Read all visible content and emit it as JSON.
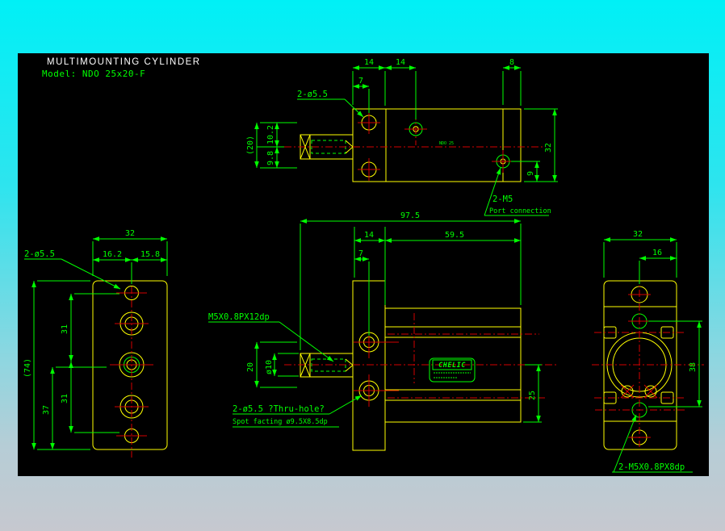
{
  "window": {
    "backdrop_top_color": "#00f0f6",
    "backdrop_bottom_color": "#c6c8cf",
    "canvas_color": "#000000"
  },
  "colors": {
    "outline": "#ffff00",
    "dimension": "#00ff00",
    "centerline": "#d40000",
    "title_text": "#ffffff"
  },
  "title": {
    "product": "MULTIMOUNTING  CYLINDER",
    "model": "Model:  NDO 25x20-F"
  },
  "views": {
    "top": {
      "dims": {
        "pitch_a": "14",
        "pitch_b": "14",
        "port_edge": "8",
        "hole_edge": "7",
        "height": "32",
        "port_depth": "9",
        "rod_len": "(20)",
        "rod_upper": "10.2",
        "rod_lower": "9.8"
      },
      "labels": {
        "holes": "2-ø5.5",
        "port": "2-M5",
        "port_caption": "Port connection",
        "marking": "NDO 25"
      }
    },
    "front": {
      "dims": {
        "total": "97.5",
        "plate": "14",
        "body": "59.5",
        "hole_edge": "7",
        "rod_block": "20",
        "rod_dia": "ø10",
        "port_offset": "25"
      },
      "labels": {
        "rod_thread": "M5X0.8PX12dp",
        "thru_hole": "2-ø5.5  ?Thru-hole?",
        "spot_face": "Spot facting  ø9.5X8.5dp"
      },
      "logo": {
        "brand": "CHELIC"
      }
    },
    "left": {
      "dims": {
        "width": "32",
        "left_half": "16.2",
        "right_half": "15.8",
        "height": "(74)",
        "pitch_top": "31",
        "pitch_bottom": "31",
        "lower": "37"
      },
      "labels": {
        "holes": "2-ø5.5"
      }
    },
    "right": {
      "dims": {
        "width": "32",
        "half": "16",
        "pitch": "38"
      },
      "labels": {
        "thread": "2-M5X0.8PX8dp"
      }
    }
  }
}
